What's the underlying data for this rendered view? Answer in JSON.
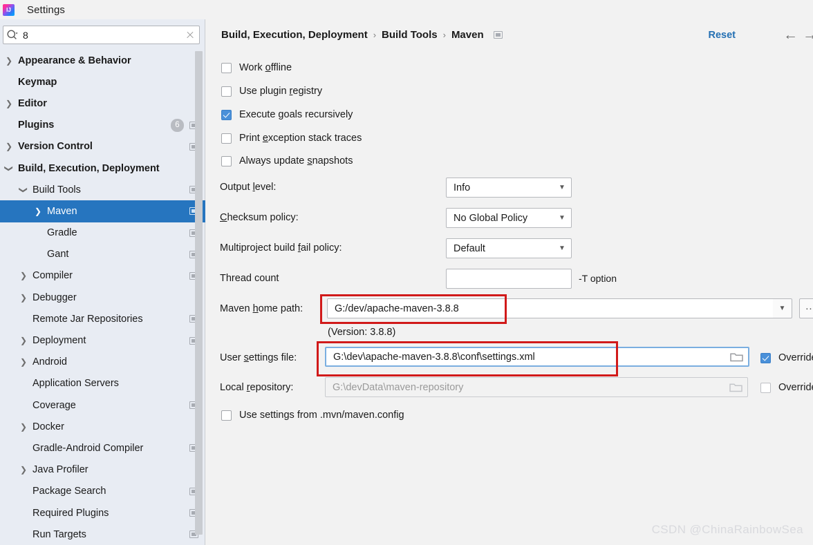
{
  "window": {
    "title": "Settings",
    "logo_icon": "intellij-idea-logo"
  },
  "search": {
    "value": "8",
    "placeholder": "",
    "icon": "search-icon",
    "clear_icon": "close-icon"
  },
  "sidebar": {
    "items": [
      {
        "label": "Appearance & Behavior",
        "indent": 0,
        "arrow": "chevron-right",
        "bold": true,
        "selected": false,
        "badge": null,
        "mini_icon": false
      },
      {
        "label": "Keymap",
        "indent": 0,
        "arrow": "none",
        "bold": true,
        "selected": false,
        "badge": null,
        "mini_icon": false
      },
      {
        "label": "Editor",
        "indent": 0,
        "arrow": "chevron-right",
        "bold": true,
        "selected": false,
        "badge": null,
        "mini_icon": false
      },
      {
        "label": "Plugins",
        "indent": 0,
        "arrow": "none",
        "bold": true,
        "selected": false,
        "badge": "6",
        "mini_icon": true
      },
      {
        "label": "Version Control",
        "indent": 0,
        "arrow": "chevron-right",
        "bold": true,
        "selected": false,
        "badge": null,
        "mini_icon": true
      },
      {
        "label": "Build, Execution, Deployment",
        "indent": 0,
        "arrow": "chevron-down",
        "bold": true,
        "selected": false,
        "badge": null,
        "mini_icon": false
      },
      {
        "label": "Build Tools",
        "indent": 1,
        "arrow": "chevron-down",
        "bold": false,
        "selected": false,
        "badge": null,
        "mini_icon": true
      },
      {
        "label": "Maven",
        "indent": 2,
        "arrow": "chevron-right",
        "bold": false,
        "selected": true,
        "badge": null,
        "mini_icon": true
      },
      {
        "label": "Gradle",
        "indent": 2,
        "arrow": "none",
        "bold": false,
        "selected": false,
        "badge": null,
        "mini_icon": true
      },
      {
        "label": "Gant",
        "indent": 2,
        "arrow": "none",
        "bold": false,
        "selected": false,
        "badge": null,
        "mini_icon": true
      },
      {
        "label": "Compiler",
        "indent": 1,
        "arrow": "chevron-right",
        "bold": false,
        "selected": false,
        "badge": null,
        "mini_icon": true
      },
      {
        "label": "Debugger",
        "indent": 1,
        "arrow": "chevron-right",
        "bold": false,
        "selected": false,
        "badge": null,
        "mini_icon": false
      },
      {
        "label": "Remote Jar Repositories",
        "indent": 1,
        "arrow": "none",
        "bold": false,
        "selected": false,
        "badge": null,
        "mini_icon": true
      },
      {
        "label": "Deployment",
        "indent": 1,
        "arrow": "chevron-right",
        "bold": false,
        "selected": false,
        "badge": null,
        "mini_icon": true
      },
      {
        "label": "Android",
        "indent": 1,
        "arrow": "chevron-right",
        "bold": false,
        "selected": false,
        "badge": null,
        "mini_icon": false
      },
      {
        "label": "Application Servers",
        "indent": 1,
        "arrow": "none",
        "bold": false,
        "selected": false,
        "badge": null,
        "mini_icon": false
      },
      {
        "label": "Coverage",
        "indent": 1,
        "arrow": "none",
        "bold": false,
        "selected": false,
        "badge": null,
        "mini_icon": true
      },
      {
        "label": "Docker",
        "indent": 1,
        "arrow": "chevron-right",
        "bold": false,
        "selected": false,
        "badge": null,
        "mini_icon": false
      },
      {
        "label": "Gradle-Android Compiler",
        "indent": 1,
        "arrow": "none",
        "bold": false,
        "selected": false,
        "badge": null,
        "mini_icon": true
      },
      {
        "label": "Java Profiler",
        "indent": 1,
        "arrow": "chevron-right",
        "bold": false,
        "selected": false,
        "badge": null,
        "mini_icon": false
      },
      {
        "label": "Package Search",
        "indent": 1,
        "arrow": "none",
        "bold": false,
        "selected": false,
        "badge": null,
        "mini_icon": true
      },
      {
        "label": "Required Plugins",
        "indent": 1,
        "arrow": "none",
        "bold": false,
        "selected": false,
        "badge": null,
        "mini_icon": true
      },
      {
        "label": "Run Targets",
        "indent": 1,
        "arrow": "none",
        "bold": false,
        "selected": false,
        "badge": null,
        "mini_icon": true
      }
    ]
  },
  "header": {
    "breadcrumb": [
      "Build, Execution, Deployment",
      "Build Tools",
      "Maven"
    ],
    "separator": "›",
    "scope_icon": "project-scope-icon",
    "reset_label": "Reset",
    "back_icon": "arrow-left-icon",
    "forward_icon": "arrow-right-icon"
  },
  "main": {
    "checkboxes": [
      {
        "label_pre": "Work ",
        "label_mnemonic": "o",
        "label_post": "ffline",
        "checked": false
      },
      {
        "label_pre": "Use plugin ",
        "label_mnemonic": "r",
        "label_post": "egistry",
        "checked": false
      },
      {
        "label_pre": "Execute ",
        "label_mnemonic": "g",
        "label_post": "oals recursively",
        "checked": true
      },
      {
        "label_pre": "Print ",
        "label_mnemonic": "e",
        "label_post": "xception stack traces",
        "checked": false
      },
      {
        "label_pre": "Always update ",
        "label_mnemonic": "s",
        "label_post": "napshots",
        "checked": false
      }
    ],
    "output_level": {
      "label_pre": "Output ",
      "label_mnemonic": "l",
      "label_post": "evel:",
      "value": "Info"
    },
    "checksum_policy": {
      "label_pre": "",
      "label_mnemonic": "C",
      "label_post": "hecksum policy:",
      "value": "No Global Policy"
    },
    "multiproject_fail_policy": {
      "label_pre": "Multiproject build ",
      "label_mnemonic": "f",
      "label_post": "ail policy:",
      "value": "Default"
    },
    "thread_count": {
      "label": "Thread count",
      "value": "",
      "hint": "-T option"
    },
    "maven_home": {
      "label_pre": "Maven ",
      "label_mnemonic": "h",
      "label_post": "ome path:",
      "value": "G:/dev/apache-maven-3.8.8",
      "version_note": "(Version: 3.8.8)",
      "dropdown_icon": "chevron-down-icon",
      "browse_label": "..."
    },
    "user_settings": {
      "label_pre": "User ",
      "label_mnemonic": "s",
      "label_post": "ettings file:",
      "value": "G:\\dev\\apache-maven-3.8.8\\conf\\settings.xml",
      "folder_icon": "folder-icon",
      "override_label": "Override",
      "override_checked": true
    },
    "local_repository": {
      "label_pre": "Local ",
      "label_mnemonic": "r",
      "label_post": "epository:",
      "value": "G:\\devData\\maven-repository",
      "disabled": true,
      "folder_icon": "folder-icon",
      "override_label": "Override",
      "override_checked": false
    },
    "use_mvn_config": {
      "label": "Use settings from .mvn/maven.config",
      "checked": false
    }
  },
  "annotations": {
    "color": "#d11a1a",
    "boxes": [
      "maven-home-path-highlight",
      "user-settings-file-highlight"
    ]
  },
  "watermark": {
    "text": "CSDN @ChinaRainbowSea"
  }
}
